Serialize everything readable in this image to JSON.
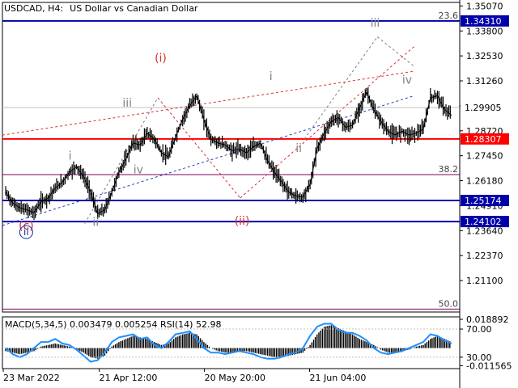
{
  "header": {
    "symbol": "USDCAD, H4:",
    "description": "US Dollar vs Canadian Dollar"
  },
  "colors": {
    "candles": "#000000",
    "grid": "#c0c0c0",
    "support_red": "#ff0000",
    "level_blue": "#0000aa",
    "fib": "#800060",
    "wave_red": "#e03030",
    "wave_gray": "#808080",
    "wave_blue": "#1a2a9a",
    "trend_red": "#d83030",
    "trend_blue": "#2040c0",
    "macd_hist": "#000000",
    "rsi": "#1e90ff"
  },
  "chart_data": {
    "type": "line",
    "ylim": [
      1.195,
      1.3525
    ],
    "price_ticks": [
      "1.35070",
      "1.33800",
      "1.32530",
      "1.31260",
      "1.29990",
      "1.28720",
      "1.27450",
      "1.26180",
      "1.24910",
      "1.23640",
      "1.22370",
      "1.21100"
    ],
    "price_tick_values": [
      1.3507,
      1.338,
      1.3253,
      1.3126,
      1.2999,
      1.2872,
      1.2745,
      1.2618,
      1.2491,
      1.2364,
      1.2237,
      1.211
    ],
    "date_ticks": [
      "23 Mar 2022",
      "21 Apr 12:00",
      "20 May 20:00",
      "21 Jun 04:00"
    ],
    "current_price": {
      "label": "1.29905",
      "value": 1.29905
    },
    "levels": [
      {
        "label": "1.34310",
        "value": 1.3431,
        "color": "level_blue",
        "width": 2
      },
      {
        "label": "1.28307",
        "value": 1.28307,
        "color": "support_red",
        "width": 2
      },
      {
        "label": "1.25174",
        "value": 1.25174,
        "color": "level_blue",
        "width": 2
      },
      {
        "label": "1.24102",
        "value": 1.24102,
        "color": "level_blue",
        "width": 2
      }
    ],
    "fib_levels": [
      {
        "label": "23.6",
        "value": 1.3431
      },
      {
        "label": "38.2",
        "value": 1.2649
      },
      {
        "label": "50.0",
        "value": 1.1965
      }
    ],
    "price_series": [
      1.256,
      1.2505,
      1.248,
      1.247,
      1.2455,
      1.251,
      1.253,
      1.258,
      1.261,
      1.266,
      1.269,
      1.264,
      1.256,
      1.245,
      1.247,
      1.256,
      1.266,
      1.273,
      1.281,
      1.28,
      1.286,
      1.283,
      1.276,
      1.274,
      1.284,
      1.293,
      1.3,
      1.305,
      1.293,
      1.283,
      1.281,
      1.28,
      1.277,
      1.278,
      1.276,
      1.279,
      1.281,
      1.272,
      1.266,
      1.261,
      1.256,
      1.254,
      1.2535,
      1.26,
      1.278,
      1.286,
      1.292,
      1.294,
      1.289,
      1.29,
      1.299,
      1.307,
      1.298,
      1.292,
      1.287,
      1.285,
      1.287,
      1.285,
      1.286,
      1.288,
      1.304,
      1.305,
      1.298,
      1.295
    ],
    "wave_labels": [
      {
        "text": "(i)",
        "t": 0.346,
        "v": 1.3222,
        "color": "wave_red",
        "size": 14
      },
      {
        "text": "(ii)",
        "t": 0.524,
        "v": 1.2395,
        "color": "wave_red",
        "size": 14
      },
      {
        "text": "(c)",
        "t": 0.052,
        "v": 1.237,
        "color": "wave_red",
        "size": 14
      },
      {
        "text": "iii",
        "t": 0.273,
        "v": 1.2995,
        "color": "wave_gray",
        "size": 14
      },
      {
        "text": "iv",
        "t": 0.297,
        "v": 1.2655,
        "color": "wave_gray",
        "size": 14
      },
      {
        "text": "i",
        "t": 0.148,
        "v": 1.2726,
        "color": "wave_gray",
        "size": 14
      },
      {
        "text": "ii",
        "t": 0.204,
        "v": 1.2387,
        "color": "wave_gray",
        "size": 14
      },
      {
        "text": "i",
        "t": 0.587,
        "v": 1.313,
        "color": "wave_gray",
        "size": 14
      },
      {
        "text": "ii",
        "t": 0.648,
        "v": 1.2764,
        "color": "wave_gray",
        "size": 14
      },
      {
        "text": "iii",
        "t": 0.815,
        "v": 1.3402,
        "color": "wave_gray",
        "size": 14
      },
      {
        "text": "iv",
        "t": 0.885,
        "v": 1.3112,
        "color": "wave_gray",
        "size": 14
      }
    ],
    "circled_label": {
      "text": "ii",
      "t": 0.052,
      "v": 1.234,
      "color": "wave_blue"
    },
    "trendlines": [
      {
        "from": [
          0.0,
          1.285
        ],
        "to": [
          0.9,
          1.3175
        ],
        "color": "trend_red",
        "dash": "3,3"
      },
      {
        "from": [
          0.0,
          1.239
        ],
        "to": [
          0.9,
          1.305
        ],
        "color": "trend_blue",
        "dash": "3,3"
      },
      {
        "from": [
          0.18,
          1.24
        ],
        "to": [
          0.34,
          1.304
        ],
        "color": "wave_gray",
        "dash": "3,3"
      },
      {
        "from": [
          0.34,
          1.304
        ],
        "to": [
          0.52,
          1.253
        ],
        "color": "trend_red",
        "dash": "3,3"
      },
      {
        "from": [
          0.52,
          1.253
        ],
        "to": [
          0.9,
          1.33
        ],
        "color": "trend_red",
        "dash": "3,3"
      },
      {
        "from": [
          0.66,
          1.283
        ],
        "to": [
          0.82,
          1.335
        ],
        "color": "wave_gray",
        "dash": "3,3"
      },
      {
        "from": [
          0.82,
          1.335
        ],
        "to": [
          0.9,
          1.32
        ],
        "color": "wave_gray",
        "dash": "3,3"
      }
    ],
    "macd": {
      "label": "MACD(5,34,5) 0.003479 0.005254 RSI(14) 52.98",
      "ticks": [
        {
          "label": "0.018892",
          "value": 0.018892
        },
        {
          "label": "70.00",
          "value": 0.0125
        },
        {
          "label": "30.00",
          "value": -0.006
        },
        {
          "label": "-0.011565",
          "value": -0.011565
        }
      ],
      "ylim": [
        -0.0135,
        0.0205
      ],
      "hist": [
        -0.002,
        -0.003,
        -0.004,
        -0.003,
        -0.002,
        0.001,
        0.002,
        0.003,
        0.002,
        0.001,
        -0.001,
        -0.003,
        -0.006,
        -0.007,
        -0.005,
        0.001,
        0.004,
        0.006,
        0.008,
        0.007,
        0.006,
        0.004,
        0.002,
        0.003,
        0.007,
        0.009,
        0.01,
        0.009,
        0.004,
        0.0,
        -0.002,
        -0.003,
        -0.003,
        -0.002,
        -0.002,
        -0.003,
        -0.004,
        -0.005,
        -0.006,
        -0.006,
        -0.005,
        -0.004,
        -0.003,
        0.002,
        0.009,
        0.014,
        0.015,
        0.013,
        0.011,
        0.009,
        0.006,
        0.004,
        0.002,
        -0.001,
        -0.003,
        -0.003,
        -0.002,
        -0.001,
        0.001,
        0.002,
        0.006,
        0.008,
        0.006,
        0.004
      ],
      "rsi": [
        0.0,
        -0.004,
        -0.006,
        -0.004,
        0.0,
        0.004,
        0.004,
        0.006,
        0.003,
        0.002,
        -0.001,
        -0.005,
        -0.009,
        -0.008,
        -0.003,
        0.004,
        0.007,
        0.008,
        0.009,
        0.006,
        0.007,
        0.002,
        0.0,
        0.004,
        0.009,
        0.01,
        0.011,
        0.006,
        0.0,
        -0.003,
        -0.003,
        -0.004,
        -0.003,
        -0.002,
        -0.003,
        -0.004,
        -0.006,
        -0.007,
        -0.007,
        -0.006,
        -0.004,
        -0.003,
        0.0,
        0.008,
        0.014,
        0.016,
        0.016,
        0.012,
        0.01,
        0.01,
        0.008,
        0.005,
        0.0,
        -0.003,
        -0.004,
        -0.003,
        -0.002,
        0.0,
        0.002,
        0.004,
        0.009,
        0.008,
        0.005,
        0.003
      ]
    }
  }
}
